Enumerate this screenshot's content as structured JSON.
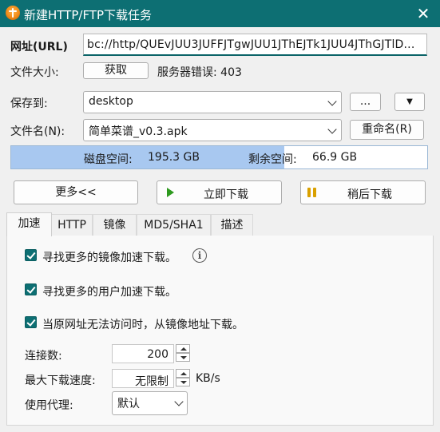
{
  "window": {
    "title": "新建HTTP/FTP下载任务",
    "close_glyph": "✕"
  },
  "url": {
    "label": "网址(URL)",
    "value": "bc://http/QUEvJUU3JUFFJTgwJUU1JThEJTk1JUU4JThGJTlD..."
  },
  "filesize": {
    "label": "文件大小:",
    "fetch_button": "获取",
    "status": "服务器错误: 403"
  },
  "save_to": {
    "label": "保存到:",
    "value": "desktop",
    "browse_button": "...",
    "menu_glyph": "▼"
  },
  "filename": {
    "label": "文件名(N):",
    "value": "简单菜谱_v0.3.apk",
    "rename_button": "重命名(R)"
  },
  "disk": {
    "space_label": "磁盘空间:",
    "space_value": "195.3 GB",
    "free_label": "剩余空间:",
    "free_value": "66.9 GB",
    "used_fraction": 0.657
  },
  "actions": {
    "more": "更多<<",
    "download_now": "立即下载",
    "download_later": "稍后下载"
  },
  "tabs": [
    "加速",
    "HTTP",
    "镜像",
    "MD5/SHA1",
    "描述"
  ],
  "accelerate": {
    "checkbox1": "寻找更多的镜像加速下载。",
    "checkbox2": "寻找更多的用户加速下载。",
    "checkbox3": "当原网址无法访问时，从镜像地址下载。",
    "info_glyph": "i",
    "connections_label": "连接数:",
    "connections_value": "200",
    "max_speed_label": "最大下载速度:",
    "max_speed_value": "无限制",
    "speed_unit": "KB/s",
    "proxy_label": "使用代理:",
    "proxy_value": "默认"
  },
  "colors": {
    "titlebar": "#0d6f73",
    "accent": "#0d6f73",
    "disk_fill": "#a8c8f0"
  }
}
